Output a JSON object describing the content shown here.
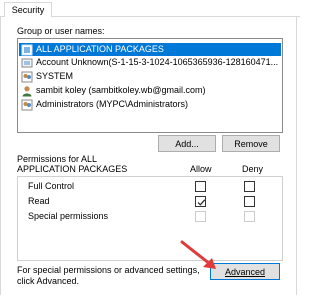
{
  "tab": {
    "label": "Security"
  },
  "group_list": {
    "label": "Group or user names:",
    "items": [
      {
        "icon": "group-icon",
        "text": "ALL APPLICATION PACKAGES",
        "selected": true
      },
      {
        "icon": "unknown-account-icon",
        "text": "Account Unknown(S-1-15-3-1024-1065365936-128160471...",
        "selected": false
      },
      {
        "icon": "group-icon",
        "text": "SYSTEM",
        "selected": false
      },
      {
        "icon": "user-icon",
        "text": "sambit koley (sambitkoley.wb@gmail.com)",
        "selected": false
      },
      {
        "icon": "group-icon",
        "text": "Administrators (MYPC\\Administrators)",
        "selected": false
      }
    ]
  },
  "buttons": {
    "add": "Add...",
    "remove": "Remove",
    "advanced": "Advanced"
  },
  "permissions": {
    "title_line1": "Permissions for ALL",
    "title_line2": "APPLICATION PACKAGES",
    "allow_header": "Allow",
    "deny_header": "Deny",
    "rows": [
      {
        "label": "Full Control",
        "allow": false,
        "deny": false,
        "enabled": true
      },
      {
        "label": "Read",
        "allow": true,
        "deny": false,
        "enabled": true
      },
      {
        "label": "Special permissions",
        "allow": false,
        "deny": false,
        "enabled": false
      }
    ]
  },
  "advanced_hint": {
    "line1": "For special permissions or advanced settings,",
    "line2": "click Advanced."
  },
  "colors": {
    "selection": "#0078d7",
    "arrow": "#e03a3a"
  }
}
